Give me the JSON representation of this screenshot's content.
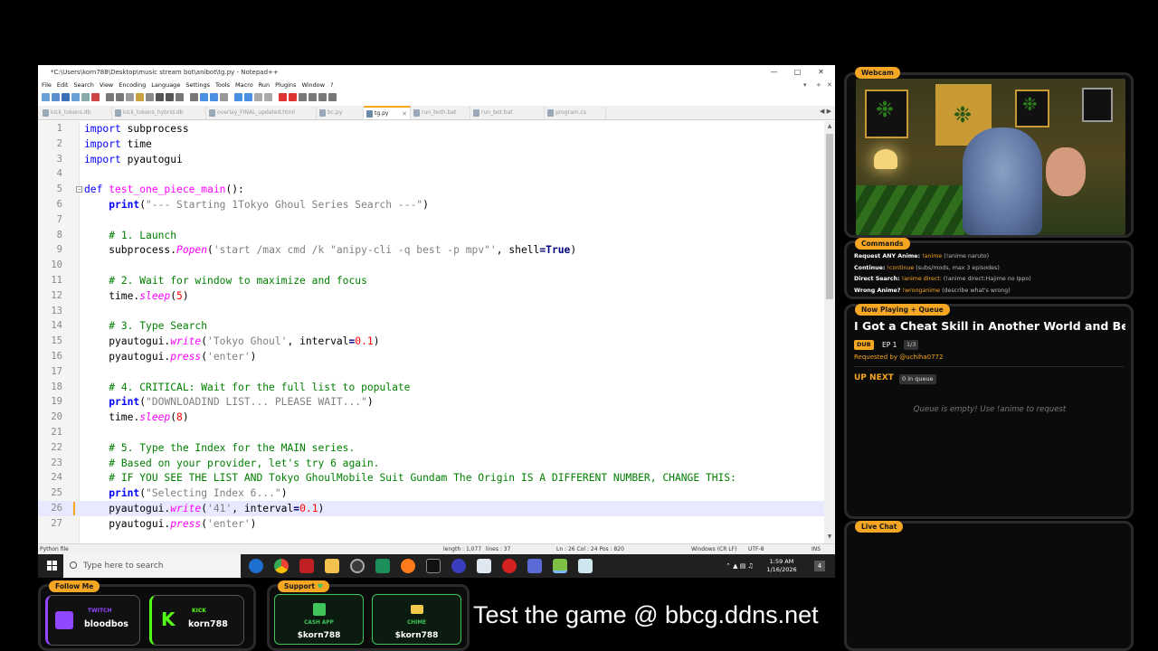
{
  "notepad": {
    "title": "*C:\\Users\\korn788\\Desktop\\music stream bot\\anibot\\tg.py - Notepad++",
    "menu": [
      "File",
      "Edit",
      "Search",
      "View",
      "Encoding",
      "Language",
      "Settings",
      "Tools",
      "Macro",
      "Run",
      "Plugins",
      "Window",
      "?"
    ],
    "tabs": [
      "kick_tokens.db",
      "kick_tokens_hybrid.db",
      "overlay_FINAL_updated.html",
      "bc.py",
      "tg.py",
      "run_both.bat",
      "run_bot.bat",
      "program.cs"
    ],
    "active_tab_index": 4,
    "lines": [
      {
        "n": "1",
        "code": "import subprocess"
      },
      {
        "n": "2",
        "code": "import time"
      },
      {
        "n": "3",
        "code": "import pyautogui"
      },
      {
        "n": "4",
        "code": ""
      },
      {
        "n": "5",
        "code": "def test_one_piece_main():"
      },
      {
        "n": "6",
        "code": "    print(\"--- Starting 1Tokyo Ghoul Series Search ---\")"
      },
      {
        "n": "7",
        "code": ""
      },
      {
        "n": "8",
        "code": "    # 1. Launch"
      },
      {
        "n": "9",
        "code": "    subprocess.Popen('start /max cmd /k \"anipy-cli -q best -p mpv\"', shell=True)"
      },
      {
        "n": "10",
        "code": ""
      },
      {
        "n": "11",
        "code": "    # 2. Wait for window to maximize and focus"
      },
      {
        "n": "12",
        "code": "    time.sleep(5)"
      },
      {
        "n": "13",
        "code": ""
      },
      {
        "n": "14",
        "code": "    # 3. Type Search"
      },
      {
        "n": "15",
        "code": "    pyautogui.write('Tokyo Ghoul', interval=0.1)"
      },
      {
        "n": "16",
        "code": "    pyautogui.press('enter')"
      },
      {
        "n": "17",
        "code": ""
      },
      {
        "n": "18",
        "code": "    # 4. CRITICAL: Wait for the full list to populate"
      },
      {
        "n": "19",
        "code": "    print(\"DOWNLOADIND LIST... PLEASE WAIT...\")"
      },
      {
        "n": "20",
        "code": "    time.sleep(8)"
      },
      {
        "n": "21",
        "code": ""
      },
      {
        "n": "22",
        "code": "    # 5. Type the Index for the MAIN series."
      },
      {
        "n": "23",
        "code": "    # Based on your provider, let's try 6 again."
      },
      {
        "n": "24",
        "code": "    # IF YOU SEE THE LIST AND Tokyo GhoulMobile Suit Gundam The Origin IS A DIFFERENT NUMBER, CHANGE THIS:"
      },
      {
        "n": "25",
        "code": "    print(\"Selecting Index 6...\")"
      },
      {
        "n": "26",
        "code": "    pyautogui.write('41', interval=0.1)"
      },
      {
        "n": "27",
        "code": "    pyautogui.press('enter')"
      }
    ],
    "current_line": "26",
    "status": {
      "filetype": "Python file",
      "length": "length : 1,077",
      "lines": "lines : 37",
      "position": "Ln : 26    Col : 24    Pos : 820",
      "eol": "Windows (CR LF)",
      "encoding": "UTF-8",
      "mode": "INS"
    }
  },
  "taskbar": {
    "search_placeholder": "Type here to search",
    "time": "1:59 AM",
    "date": "1/16/2026"
  },
  "overlay": {
    "webcam_label": "Webcam",
    "commands_label": "Commands",
    "commands": [
      {
        "label": "Request ANY Anime:",
        "cmd": "!anime",
        "hint": "(!anime naruto)"
      },
      {
        "label": "Continue:",
        "cmd": "!continue",
        "hint": "(subs/mods, max 3 episodes)"
      },
      {
        "label": "Direct Search:",
        "cmd": "!anime direct:",
        "hint": "(!anime direct:Hajime no Ippo)"
      },
      {
        "label": "Wrong Anime?",
        "cmd": "!wronganime",
        "hint": "(describe what's wrong)"
      }
    ],
    "now_playing_label": "Now Playing + Queue",
    "now_playing_title": "I Got a Cheat Skill in Another World and Bec...",
    "dub_badge": "DUB",
    "episode": "EP 1",
    "episode_count": "1/3",
    "requested_by": "Requested by @uchiha0772",
    "up_next": "UP NEXT",
    "queue_count": "0 in queue",
    "queue_empty": "Queue is empty! Use !anime to request",
    "live_chat_label": "Live Chat",
    "follow_me_label": "Follow Me",
    "twitch_label": "TWITCH",
    "twitch_name": "bloodbos",
    "kick_label": "KICK",
    "kick_name": "korn788",
    "support_label": "Support",
    "cashapp_label": "CASH APP",
    "cashapp_name": "$korn788",
    "chime_label": "CHIME",
    "chime_name": "$korn788",
    "promo": "Test the game @ bbcg.ddns.net"
  },
  "colors": {
    "accent": "#f5a623",
    "support_green": "#3fc45a",
    "twitch_purple": "#9146ff",
    "kick_green": "#53fc18"
  }
}
